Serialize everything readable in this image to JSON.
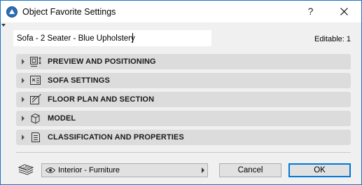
{
  "window": {
    "title": "Object Favorite Settings",
    "help_label": "?",
    "close_icon": "close-icon",
    "app_icon": "archicad-icon",
    "border_color": "#1c74c7"
  },
  "header": {
    "name_value": "Sofa - 2 Seater - Blue Upholstery",
    "editable_label": "Editable: 1"
  },
  "sections": [
    {
      "label": "PREVIEW AND POSITIONING",
      "icon": "preview-positioning-icon"
    },
    {
      "label": "SOFA SETTINGS",
      "icon": "object-settings-icon"
    },
    {
      "label": "FLOOR PLAN AND SECTION",
      "icon": "floor-plan-icon"
    },
    {
      "label": "MODEL",
      "icon": "model-cube-icon"
    },
    {
      "label": "CLASSIFICATION AND PROPERTIES",
      "icon": "classification-icon"
    }
  ],
  "footer": {
    "layers_icon": "layers-icon",
    "layer_value": "Interior - Furniture",
    "layer_icon": "eye-icon",
    "cancel_label": "Cancel",
    "ok_label": "OK",
    "ok_accent": "#0078d7"
  }
}
